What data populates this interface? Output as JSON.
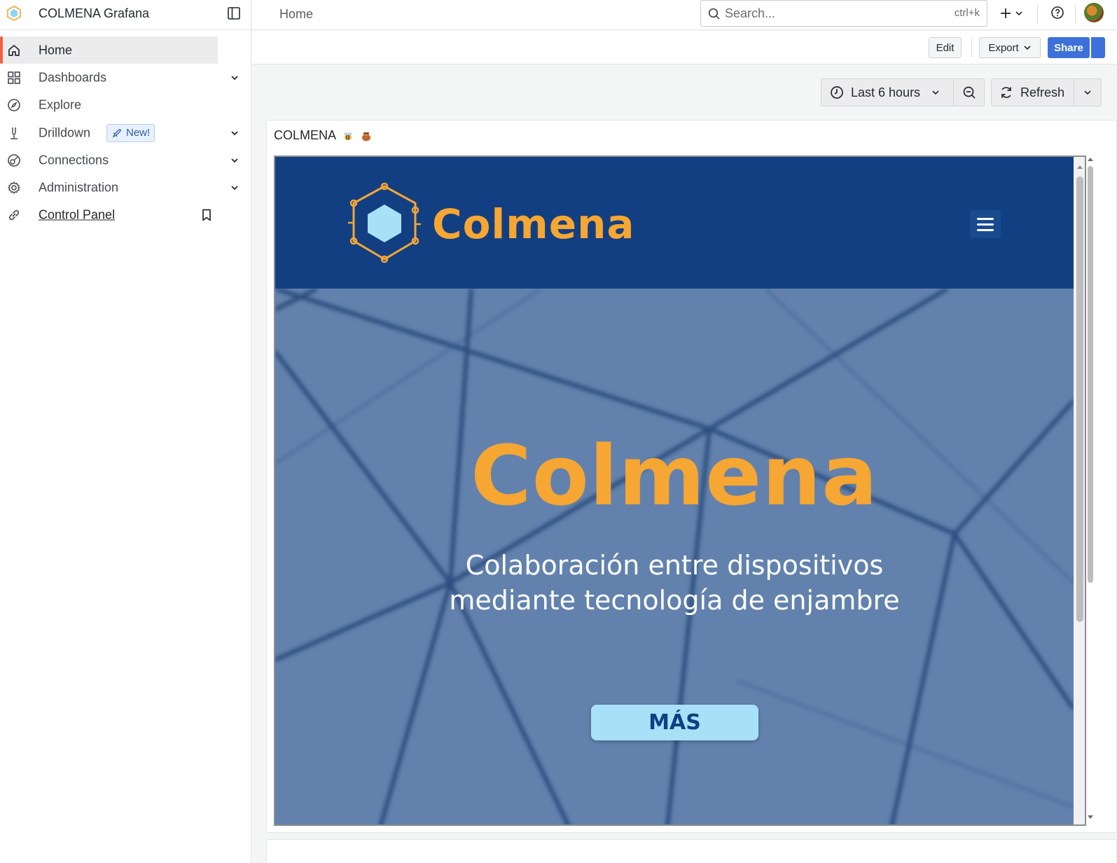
{
  "app": {
    "title": "COLMENA Grafana"
  },
  "sidebar": {
    "items": [
      {
        "label": "Home",
        "icon": "home-icon",
        "active": true
      },
      {
        "label": "Dashboards",
        "icon": "dashboards-icon",
        "expandable": true
      },
      {
        "label": "Explore",
        "icon": "compass-icon"
      },
      {
        "label": "Drilldown",
        "icon": "drilldown-icon",
        "expandable": true,
        "badge": "New!"
      },
      {
        "label": "Connections",
        "icon": "connections-icon",
        "expandable": true
      },
      {
        "label": "Administration",
        "icon": "gear-icon",
        "expandable": true
      },
      {
        "label": "Control Panel",
        "icon": "link-icon",
        "bookmarked": true
      }
    ]
  },
  "topbar": {
    "breadcrumb": "Home",
    "search_placeholder": "Search...",
    "search_shortcut": "ctrl+k"
  },
  "dashboard_toolbar": {
    "edit_label": "Edit",
    "export_label": "Export",
    "share_label": "Share"
  },
  "time_controls": {
    "range_label": "Last 6 hours",
    "refresh_label": "Refresh"
  },
  "panel": {
    "title": "COLMENA"
  },
  "embedded_site": {
    "logo_text": "Colmena",
    "hero_title": "Colmena",
    "hero_subtitle_line1": "Colaboración entre dispositivos",
    "hero_subtitle_line2": "mediante tecnología de enjambre",
    "cta_label": "MÁS"
  },
  "colors": {
    "accent": "#f55f3e",
    "primary": "#3d71d9",
    "site_navy": "#123f82",
    "site_orange": "#f6a632",
    "hero_blue": "#6282ad",
    "cta_light_blue": "#a8e0f7"
  }
}
